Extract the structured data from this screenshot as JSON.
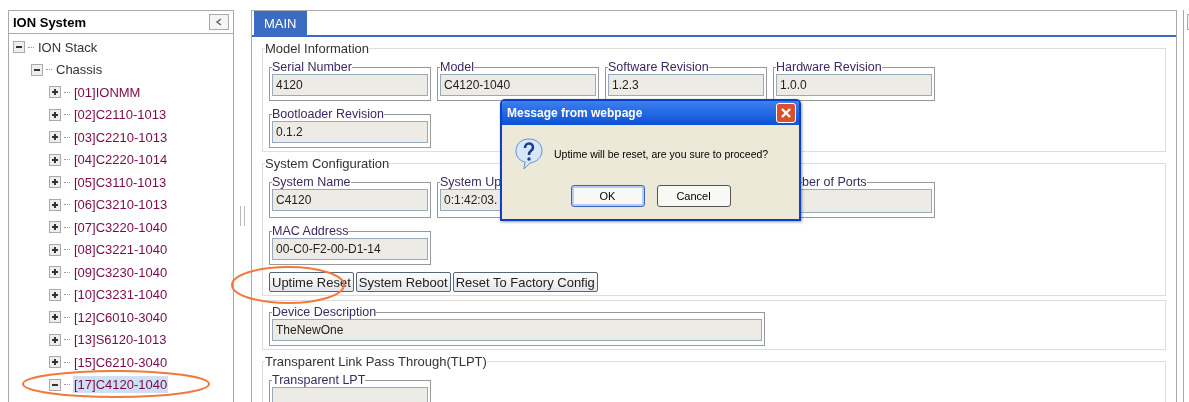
{
  "sidebar": {
    "title": "ION System",
    "tree": [
      {
        "label": "ION Stack",
        "expanded": true,
        "selected": false,
        "children": [
          {
            "label": "Chassis",
            "expanded": true,
            "selected": false,
            "children": [
              {
                "label": "[01]IONMM",
                "expanded": false,
                "selected": false
              },
              {
                "label": "[02]C2110-1013",
                "expanded": false,
                "selected": false
              },
              {
                "label": "[03]C2210-1013",
                "expanded": false,
                "selected": false
              },
              {
                "label": "[04]C2220-1014",
                "expanded": false,
                "selected": false
              },
              {
                "label": "[05]C3110-1013",
                "expanded": false,
                "selected": false
              },
              {
                "label": "[06]C3210-1013",
                "expanded": false,
                "selected": false
              },
              {
                "label": "[07]C3220-1040",
                "expanded": false,
                "selected": false
              },
              {
                "label": "[08]C3221-1040",
                "expanded": false,
                "selected": false
              },
              {
                "label": "[09]C3230-1040",
                "expanded": false,
                "selected": false
              },
              {
                "label": "[10]C3231-1040",
                "expanded": false,
                "selected": false
              },
              {
                "label": "[12]C6010-3040",
                "expanded": false,
                "selected": false
              },
              {
                "label": "[13]S6120-1013",
                "expanded": false,
                "selected": false
              },
              {
                "label": "[15]C6210-3040",
                "expanded": false,
                "selected": false
              },
              {
                "label": "[17]C4120-1040",
                "expanded": true,
                "selected": true
              }
            ]
          }
        ]
      }
    ]
  },
  "tabs": [
    {
      "label": "MAIN",
      "selected": true
    }
  ],
  "sections": [
    {
      "title": "Model Information",
      "rows": [
        [
          {
            "label": "Serial Number",
            "value": "4120"
          },
          {
            "label": "Model",
            "value": "C4120-1040"
          },
          {
            "label": "Software Revision",
            "value": "1.2.3"
          },
          {
            "label": "Hardware Revision",
            "value": "1.0.0"
          }
        ],
        [
          {
            "label": "Bootloader Revision",
            "value": "0.1.2"
          }
        ]
      ]
    },
    {
      "title": "System Configuration",
      "rows": [
        [
          {
            "label": "System Name",
            "value": "C4120"
          },
          {
            "label": "System Up",
            "value": "0:1:42:03."
          },
          {},
          {
            "label": "ber of Ports"
          }
        ],
        [
          {
            "label": "MAC Address",
            "value": "00-C0-F2-00-D1-14"
          }
        ]
      ],
      "buttons": [
        "Uptime Reset",
        "System Reboot",
        "Reset To Factory Config"
      ]
    },
    {
      "rows": [
        [
          {
            "label": "Device Description",
            "value": "TheNewOne",
            "wide": true
          }
        ]
      ]
    },
    {
      "title": "Transparent Link Pass Through(TLPT)",
      "rows": [
        [
          {
            "label": "Transparent LPT"
          }
        ]
      ]
    }
  ],
  "dialog": {
    "title": "Message from webpage",
    "message": "Uptime will be reset, are you sure to proceed?",
    "buttons": [
      {
        "label": "OK",
        "default": true
      },
      {
        "label": "Cancel",
        "default": false
      }
    ]
  }
}
